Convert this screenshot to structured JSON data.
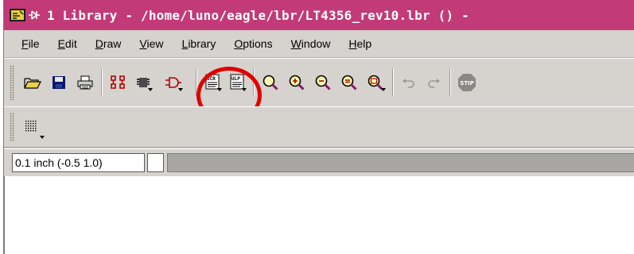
{
  "window": {
    "title": "1 Library - /home/luno/eagle/lbr/LT4356_rev10.lbr () -",
    "title_icons": [
      "eagle-app-icon",
      "window-menu-icon"
    ]
  },
  "menubar": {
    "items": [
      "File",
      "Edit",
      "Draw",
      "View",
      "Library",
      "Options",
      "Window",
      "Help"
    ]
  },
  "toolbar": {
    "tools": [
      {
        "name": "open-icon"
      },
      {
        "name": "save-icon"
      },
      {
        "name": "print-icon"
      },
      {
        "name": "device-icon"
      },
      {
        "name": "package-icon"
      },
      {
        "name": "symbol-icon",
        "highlighted": true
      },
      {
        "name": "script-icon"
      },
      {
        "name": "ulp-icon"
      },
      {
        "name": "zoom-fit-icon"
      },
      {
        "name": "zoom-in-icon"
      },
      {
        "name": "zoom-out-icon"
      },
      {
        "name": "zoom-redraw-icon"
      },
      {
        "name": "zoom-select-icon"
      },
      {
        "name": "undo-icon"
      },
      {
        "name": "redo-icon"
      },
      {
        "name": "stop-icon",
        "label": "STIP"
      }
    ],
    "secondary": [
      {
        "name": "grid-icon"
      }
    ]
  },
  "statusbar": {
    "coordinates": "0.1 inch (-0.5 1.0)"
  },
  "colors": {
    "titlebar": "#c23a77",
    "highlight": "#e00000",
    "toolbar_bg": "#d6d3ce"
  }
}
